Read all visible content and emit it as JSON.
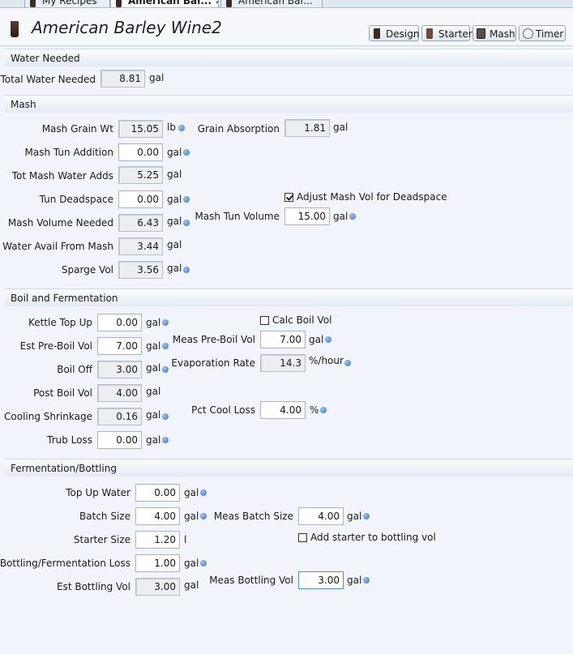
{
  "tabs": [
    {
      "label": "My Recipes"
    },
    {
      "label": "American Bar...",
      "close": "✕"
    },
    {
      "label": "American Bar..."
    }
  ],
  "header": {
    "title": "American Barley Wine2",
    "buttons": {
      "design": "Design",
      "starter": "Starter",
      "mash": "Mash",
      "timer": "Timer"
    }
  },
  "water": {
    "section": "Water Needed",
    "total": {
      "label": "Total Water Needed",
      "value": "8.81",
      "unit": "gal"
    }
  },
  "mash": {
    "section": "Mash",
    "grain_wt": {
      "label": "Mash Grain Wt",
      "value": "15.05",
      "unit": "lb"
    },
    "tun_addition": {
      "label": "Mash Tun Addition",
      "value": "0.00",
      "unit": "gal"
    },
    "tot_water_adds": {
      "label": "Tot Mash Water Adds",
      "value": "5.25",
      "unit": "gal"
    },
    "tun_deadspace": {
      "label": "Tun Deadspace",
      "value": "0.00",
      "unit": "gal"
    },
    "volume_needed": {
      "label": "Mash Volume Needed",
      "value": "6.43",
      "unit": "gal"
    },
    "water_avail": {
      "label": "Water Avail From Mash",
      "value": "3.44",
      "unit": "gal"
    },
    "sparge_vol": {
      "label": "Sparge Vol",
      "value": "3.56",
      "unit": "gal"
    },
    "grain_absorption": {
      "label": "Grain Absorption",
      "value": "1.81",
      "unit": "gal"
    },
    "adjust_deadspace": {
      "label": "Adjust Mash Vol for Deadspace",
      "checked": true
    },
    "tun_volume": {
      "label": "Mash Tun Volume",
      "value": "15.00",
      "unit": "gal"
    }
  },
  "boil": {
    "section": "Boil and Fermentation",
    "kettle_top_up": {
      "label": "Kettle Top Up",
      "value": "0.00",
      "unit": "gal"
    },
    "est_pre_boil": {
      "label": "Est Pre-Boil Vol",
      "value": "7.00",
      "unit": "gal"
    },
    "boil_off": {
      "label": "Boil Off",
      "value": "3.00",
      "unit": "gal"
    },
    "post_boil": {
      "label": "Post Boil Vol",
      "value": "4.00",
      "unit": "gal"
    },
    "cooling_shrinkage": {
      "label": "Cooling Shrinkage",
      "value": "0.16",
      "unit": "gal"
    },
    "trub_loss": {
      "label": "Trub Loss",
      "value": "0.00",
      "unit": "gal"
    },
    "calc_boil_vol": {
      "label": "Calc Boil Vol",
      "checked": false
    },
    "meas_pre_boil": {
      "label": "Meas Pre-Boil Vol",
      "value": "7.00",
      "unit": "gal"
    },
    "evaporation": {
      "label": "Evaporation Rate",
      "value": "14.3",
      "unit": "%/hour"
    },
    "pct_cool_loss": {
      "label": "Pct Cool Loss",
      "value": "4.00",
      "unit": "%"
    }
  },
  "ferm": {
    "section": "Fermentation/Bottling",
    "top_up_water": {
      "label": "Top Up Water",
      "value": "0.00",
      "unit": "gal"
    },
    "batch_size": {
      "label": "Batch Size",
      "value": "4.00",
      "unit": "gal"
    },
    "starter_size": {
      "label": "Starter Size",
      "value": "1.20",
      "unit": "l"
    },
    "bottling_loss": {
      "label": "Bottling/Fermentation Loss",
      "value": "1.00",
      "unit": "gal"
    },
    "est_bottling": {
      "label": "Est Bottling Vol",
      "value": "3.00",
      "unit": "gal"
    },
    "meas_batch_size": {
      "label": "Meas Batch Size",
      "value": "4.00",
      "unit": "gal"
    },
    "add_starter": {
      "label": "Add starter to bottling vol",
      "checked": false
    },
    "meas_bottling": {
      "label": "Meas Bottling Vol",
      "value": "3.00",
      "unit": "gal"
    }
  }
}
